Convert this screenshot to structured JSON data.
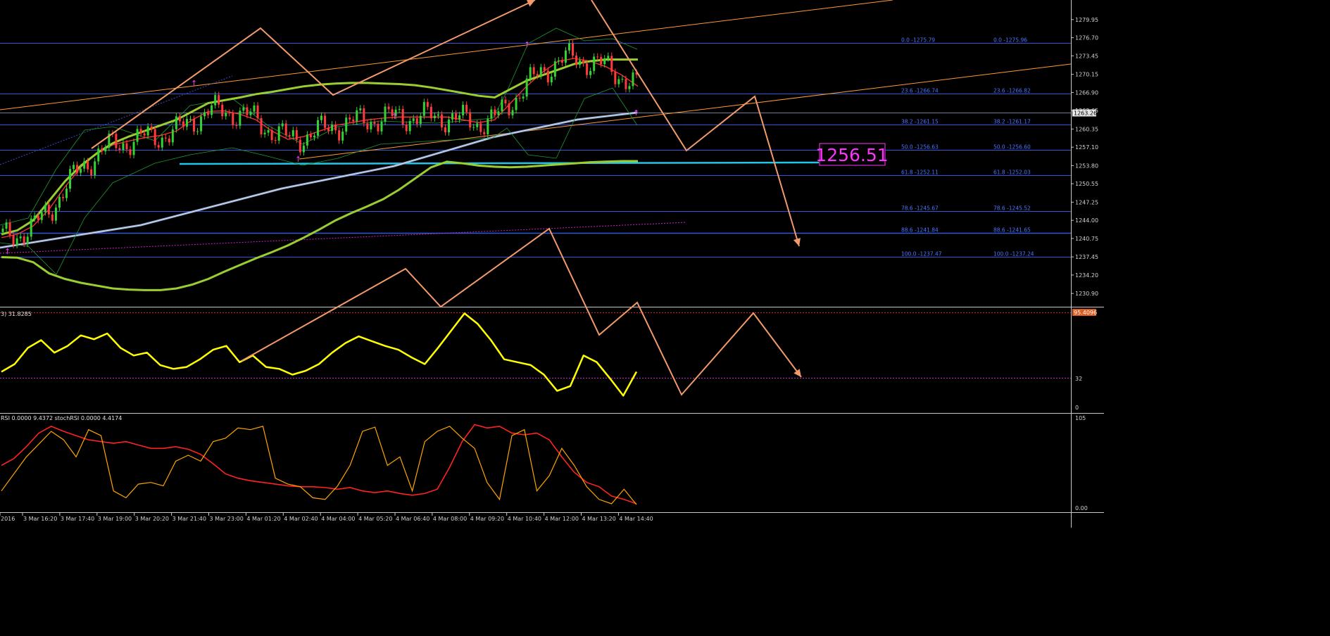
{
  "chart_data": [
    {
      "type": "line",
      "ylim": [
        1228.9,
        1282.7
      ],
      "x_ticks": [
        "2016",
        "3 Mar 16:20",
        "3 Mar 17:40",
        "3 Mar 19:00",
        "3 Mar 20:20",
        "3 Mar 21:40",
        "3 Mar 23:00",
        "4 Mar 01:20",
        "4 Mar 02:40",
        "4 Mar 04:00",
        "4 Mar 05:20",
        "4 Mar 06:40",
        "4 Mar 08:00",
        "4 Mar 09:20",
        "4 Mar 10:40",
        "4 Mar 12:00",
        "4 Mar 13:20",
        "4 Mar 14:40"
      ],
      "y_ticks": [
        "1279.95",
        "1276.70",
        "1273.45",
        "1270.15",
        "1266.90",
        "1263.65",
        "1260.35",
        "1257.10",
        "1253.80",
        "1250.55",
        "1247.25",
        "1244.00",
        "1240.75",
        "1237.45",
        "1234.20",
        "1230.90"
      ],
      "current_price": "1263.26",
      "target_label": "1256.51",
      "fib_left": [
        {
          "text": "0.0 -1275.79",
          "value": 1275.8
        },
        {
          "text": "23.6 -1266.74",
          "value": 1266.75
        },
        {
          "text": "38.2 -1261.15",
          "value": 1261.15
        },
        {
          "text": "50.0 -1256.63",
          "value": 1256.62
        },
        {
          "text": "61.8 -1252.11",
          "value": 1252.1
        },
        {
          "text": "78.6 -1245.67",
          "value": 1245.65
        },
        {
          "text": "88.6 -1241.84",
          "value": 1241.8
        },
        {
          "text": "100.0 -1237.47",
          "value": 1237.45
        }
      ],
      "fib_right": [
        {
          "text": "0.0 -1275.96"
        },
        {
          "text": "23.6 -1266.82"
        },
        {
          "text": "38.2 -1261.17"
        },
        {
          "text": "50.0 -1256.60"
        },
        {
          "text": "61.8 -1252.03"
        },
        {
          "text": "78.6 -1245.52"
        },
        {
          "text": "88.6 -1241.65"
        },
        {
          "text": "100.0 -1237.24"
        }
      ],
      "series": [
        {
          "color": "#ff3333",
          "values": [
            1240.9,
            1241.5,
            1243.0,
            1246.0,
            1250.0,
            1253.5,
            1256.0,
            1257.5,
            1258.2,
            1258.8,
            1259.2,
            1260.0,
            1262.0,
            1263.5,
            1263.6,
            1263.0,
            1262.0,
            1260.0,
            1258.5,
            1259.0,
            1260.0,
            1261.0,
            1261.5,
            1262.0,
            1262.3,
            1262.5,
            1262.5,
            1262.5,
            1262.5,
            1262.0,
            1261.5,
            1262.0,
            1265.0,
            1268.0,
            1270.5,
            1272.5,
            1273.0,
            1272.5,
            1271.5,
            1270.0,
            1268.0
          ]
        },
        {
          "color": "#9acd32",
          "values": [
            1241.5,
            1242.2,
            1244.0,
            1247.5,
            1251.0,
            1253.8,
            1256.0,
            1257.8,
            1259.0,
            1260.0,
            1261.0,
            1262.0,
            1263.5,
            1265.0,
            1265.5,
            1266.0,
            1266.6,
            1267.0,
            1267.5,
            1268.0,
            1268.3,
            1268.5,
            1268.6,
            1268.6,
            1268.5,
            1268.4,
            1268.2,
            1267.8,
            1267.3,
            1266.8,
            1266.3,
            1266.0,
            1267.5,
            1269.0,
            1270.0,
            1271.0,
            1272.0,
            1272.5,
            1272.8,
            1272.8,
            1272.8
          ]
        },
        {
          "color": "#9acd32",
          "values": [
            1237.4,
            1237.3,
            1236.5,
            1234.5,
            1233.5,
            1232.8,
            1232.3,
            1231.8,
            1231.6,
            1231.5,
            1231.5,
            1231.8,
            1232.5,
            1233.5,
            1234.8,
            1236.0,
            1237.2,
            1238.3,
            1239.5,
            1240.9,
            1242.4,
            1244.0,
            1245.3,
            1246.5,
            1247.8,
            1249.5,
            1251.5,
            1253.5,
            1254.5,
            1254.2,
            1253.8,
            1253.6,
            1253.5,
            1253.6,
            1253.8,
            1254.0,
            1254.2,
            1254.4,
            1254.5,
            1254.6,
            1254.6
          ]
        }
      ]
    },
    {
      "type": "line",
      "title": "3) 31.8285",
      "level_label": "32",
      "zero_label": "0",
      "value_badge": "95.4096",
      "ylim": [
        0,
        100
      ],
      "values": [
        35,
        43,
        60,
        68,
        55,
        62,
        73,
        69,
        75,
        60,
        52,
        55,
        42,
        38,
        40,
        48,
        58,
        62,
        45,
        52,
        40,
        38,
        32,
        36,
        43,
        55,
        65,
        72,
        67,
        62,
        58,
        50,
        43,
        60,
        78,
        96,
        85,
        68,
        48,
        45,
        42,
        32,
        15,
        20,
        52,
        45,
        28,
        10,
        35
      ]
    },
    {
      "type": "line",
      "title": "RSI 0.0000 9.4372  stochRSI 0.0000 4.4174",
      "ylim": [
        0,
        105
      ],
      "y_ticks": [
        "105",
        "0.00"
      ],
      "series": [
        {
          "color": "#ff2222",
          "values": [
            50,
            58,
            72,
            88,
            96,
            90,
            85,
            80,
            78,
            76,
            78,
            74,
            70,
            70,
            72,
            69,
            63,
            52,
            40,
            35,
            32,
            30,
            28,
            26,
            25,
            25,
            24,
            22,
            24,
            20,
            18,
            20,
            17,
            15,
            17,
            22,
            48,
            78,
            98,
            94,
            96,
            88,
            86,
            88,
            80,
            60,
            42,
            30,
            25,
            14,
            10,
            5
          ]
        },
        {
          "color": "#ffa500",
          "values": [
            20,
            40,
            60,
            75,
            90,
            80,
            60,
            92,
            85,
            20,
            12,
            28,
            30,
            26,
            55,
            62,
            55,
            78,
            82,
            94,
            92,
            96,
            35,
            28,
            25,
            12,
            10,
            26,
            50,
            90,
            95,
            50,
            60,
            20,
            78,
            90,
            96,
            82,
            70,
            30,
            10,
            85,
            92,
            20,
            38,
            70,
            50,
            25,
            10,
            5,
            22,
            4
          ]
        }
      ]
    }
  ]
}
